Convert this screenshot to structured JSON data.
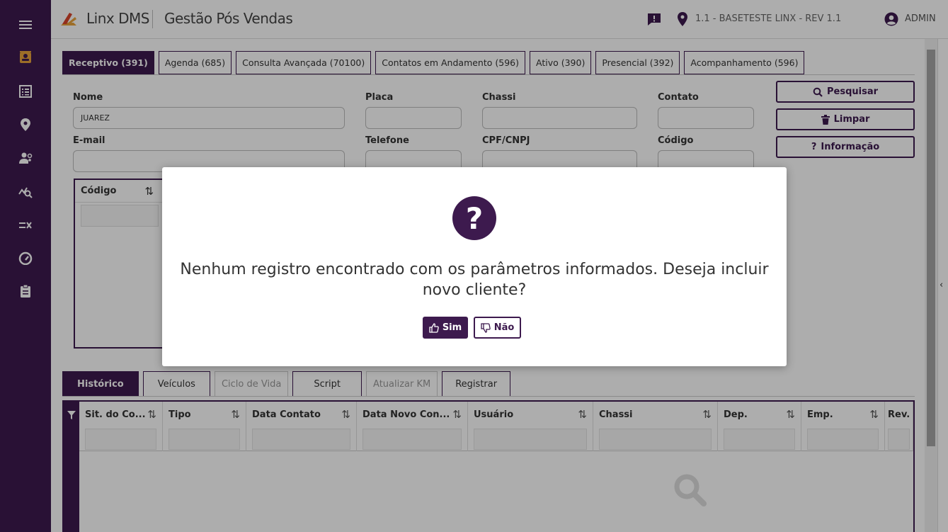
{
  "header": {
    "brand": "Linx DMS",
    "module": "Gestão Pós Vendas",
    "branch": "1.1 - BASETESTE LINX - REV 1.1",
    "user": "ADMIN"
  },
  "sidebar": {
    "items": [
      "menu-icon",
      "contact-card-icon",
      "list-icon",
      "location-pin-icon",
      "users-gear-icon",
      "chart-search-icon",
      "list-x-icon",
      "gauge-icon",
      "clipboard-icon"
    ]
  },
  "tabs_top": [
    "Receptivo (391)",
    "Agenda (685)",
    "Consulta Avançada (70100)",
    "Contatos em Andamento (596)",
    "Ativo (390)",
    "Presencial (392)",
    "Acompanhamento (596)"
  ],
  "form": {
    "nome_label": "Nome",
    "nome_value": "JUAREZ",
    "placa_label": "Placa",
    "chassi_label": "Chassi",
    "contato_label": "Contato",
    "email_label": "E-mail",
    "telefone_label": "Telefone",
    "cpf_label": "CPF/CNPJ",
    "codigo_label": "Código"
  },
  "side_buttons": {
    "pesquisar": "Pesquisar",
    "limpar": "Limpar",
    "informacao": "Informação"
  },
  "grid_top": {
    "col_codigo": "Código",
    "sort_glyph": "⇅"
  },
  "tabs_bottom": [
    "Histórico",
    "Veículos",
    "Ciclo de Vida",
    "Script",
    "Atualizar KM",
    "Registrar"
  ],
  "grid_bottom": {
    "columns": [
      "Sit. do Co...",
      "Tipo",
      "Data Contato",
      "Data Novo Con...",
      "Usuário",
      "Chassi",
      "Dep.",
      "Emp.",
      "Rev."
    ]
  },
  "modal": {
    "message": "Nenhum registro encontrado com os parâmetros informados. Deseja incluir novo cliente?",
    "yes_label": "Sim",
    "no_label": "Não"
  },
  "colors": {
    "primary": "#3d1a4e",
    "accent": "#e8a33b"
  }
}
